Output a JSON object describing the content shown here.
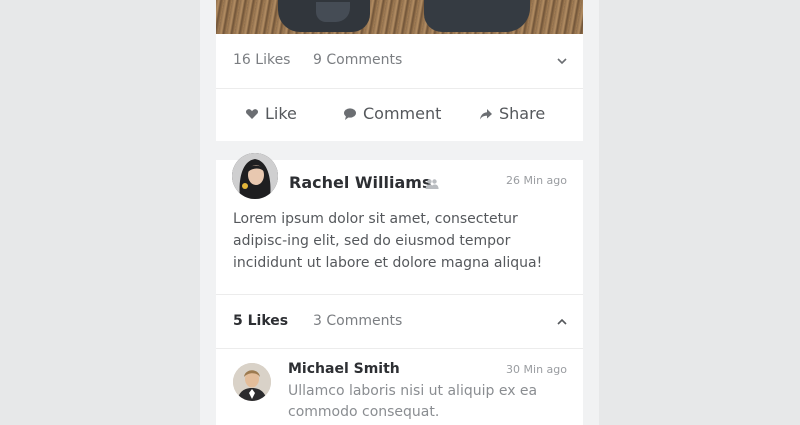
{
  "top_post": {
    "likes_label": "16 Likes",
    "comments_label": "9 Comments",
    "actions": {
      "like": "Like",
      "comment": "Comment",
      "share": "Share"
    }
  },
  "post": {
    "author": "Rachel Williams",
    "time": "26 Min ago",
    "body": "Lorem ipsum dolor sit amet, consectetur adipisc-ing elit, sed do eiusmod tempor incididunt ut labore et dolore magna aliqua!",
    "likes_label": "5 Likes",
    "comments_label": "3 Comments",
    "comments": [
      {
        "author": "Michael Smith",
        "time": "30 Min ago",
        "body": "Ullamco laboris nisi ut aliquip ex ea commodo consequat."
      }
    ]
  }
}
